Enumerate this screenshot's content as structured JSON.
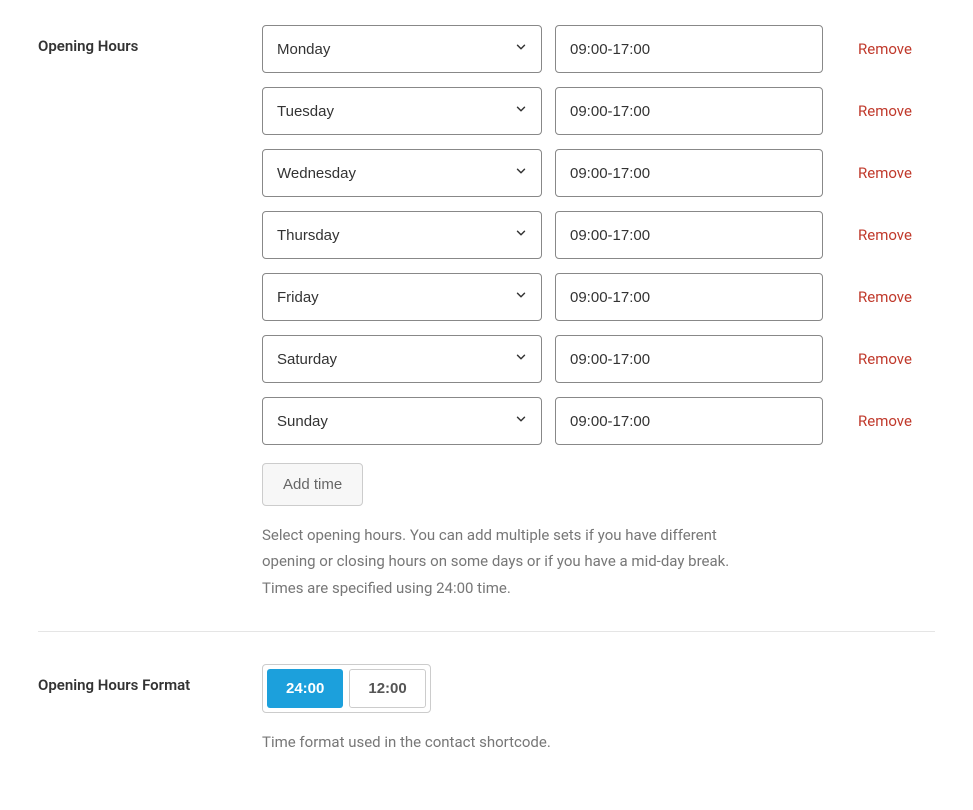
{
  "opening_hours": {
    "label": "Opening Hours",
    "rows": [
      {
        "day": "Monday",
        "time": "09:00-17:00",
        "remove": "Remove"
      },
      {
        "day": "Tuesday",
        "time": "09:00-17:00",
        "remove": "Remove"
      },
      {
        "day": "Wednesday",
        "time": "09:00-17:00",
        "remove": "Remove"
      },
      {
        "day": "Thursday",
        "time": "09:00-17:00",
        "remove": "Remove"
      },
      {
        "day": "Friday",
        "time": "09:00-17:00",
        "remove": "Remove"
      },
      {
        "day": "Saturday",
        "time": "09:00-17:00",
        "remove": "Remove"
      },
      {
        "day": "Sunday",
        "time": "09:00-17:00",
        "remove": "Remove"
      }
    ],
    "add_button": "Add time",
    "help": "Select opening hours. You can add multiple sets if you have different opening or closing hours on some days or if you have a mid-day break. Times are specified using 24:00 time."
  },
  "format": {
    "label": "Opening Hours Format",
    "option_24": "24:00",
    "option_12": "12:00",
    "help": "Time format used in the contact shortcode."
  }
}
